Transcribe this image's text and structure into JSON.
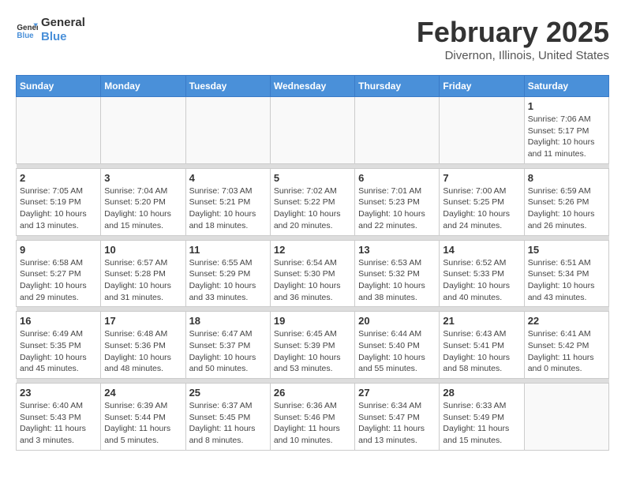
{
  "header": {
    "logo_line1": "General",
    "logo_line2": "Blue",
    "month_title": "February 2025",
    "location": "Divernon, Illinois, United States"
  },
  "weekdays": [
    "Sunday",
    "Monday",
    "Tuesday",
    "Wednesday",
    "Thursday",
    "Friday",
    "Saturday"
  ],
  "weeks": [
    [
      {
        "day": "",
        "info": ""
      },
      {
        "day": "",
        "info": ""
      },
      {
        "day": "",
        "info": ""
      },
      {
        "day": "",
        "info": ""
      },
      {
        "day": "",
        "info": ""
      },
      {
        "day": "",
        "info": ""
      },
      {
        "day": "1",
        "info": "Sunrise: 7:06 AM\nSunset: 5:17 PM\nDaylight: 10 hours\nand 11 minutes."
      }
    ],
    [
      {
        "day": "2",
        "info": "Sunrise: 7:05 AM\nSunset: 5:19 PM\nDaylight: 10 hours\nand 13 minutes."
      },
      {
        "day": "3",
        "info": "Sunrise: 7:04 AM\nSunset: 5:20 PM\nDaylight: 10 hours\nand 15 minutes."
      },
      {
        "day": "4",
        "info": "Sunrise: 7:03 AM\nSunset: 5:21 PM\nDaylight: 10 hours\nand 18 minutes."
      },
      {
        "day": "5",
        "info": "Sunrise: 7:02 AM\nSunset: 5:22 PM\nDaylight: 10 hours\nand 20 minutes."
      },
      {
        "day": "6",
        "info": "Sunrise: 7:01 AM\nSunset: 5:23 PM\nDaylight: 10 hours\nand 22 minutes."
      },
      {
        "day": "7",
        "info": "Sunrise: 7:00 AM\nSunset: 5:25 PM\nDaylight: 10 hours\nand 24 minutes."
      },
      {
        "day": "8",
        "info": "Sunrise: 6:59 AM\nSunset: 5:26 PM\nDaylight: 10 hours\nand 26 minutes."
      }
    ],
    [
      {
        "day": "9",
        "info": "Sunrise: 6:58 AM\nSunset: 5:27 PM\nDaylight: 10 hours\nand 29 minutes."
      },
      {
        "day": "10",
        "info": "Sunrise: 6:57 AM\nSunset: 5:28 PM\nDaylight: 10 hours\nand 31 minutes."
      },
      {
        "day": "11",
        "info": "Sunrise: 6:55 AM\nSunset: 5:29 PM\nDaylight: 10 hours\nand 33 minutes."
      },
      {
        "day": "12",
        "info": "Sunrise: 6:54 AM\nSunset: 5:30 PM\nDaylight: 10 hours\nand 36 minutes."
      },
      {
        "day": "13",
        "info": "Sunrise: 6:53 AM\nSunset: 5:32 PM\nDaylight: 10 hours\nand 38 minutes."
      },
      {
        "day": "14",
        "info": "Sunrise: 6:52 AM\nSunset: 5:33 PM\nDaylight: 10 hours\nand 40 minutes."
      },
      {
        "day": "15",
        "info": "Sunrise: 6:51 AM\nSunset: 5:34 PM\nDaylight: 10 hours\nand 43 minutes."
      }
    ],
    [
      {
        "day": "16",
        "info": "Sunrise: 6:49 AM\nSunset: 5:35 PM\nDaylight: 10 hours\nand 45 minutes."
      },
      {
        "day": "17",
        "info": "Sunrise: 6:48 AM\nSunset: 5:36 PM\nDaylight: 10 hours\nand 48 minutes."
      },
      {
        "day": "18",
        "info": "Sunrise: 6:47 AM\nSunset: 5:37 PM\nDaylight: 10 hours\nand 50 minutes."
      },
      {
        "day": "19",
        "info": "Sunrise: 6:45 AM\nSunset: 5:39 PM\nDaylight: 10 hours\nand 53 minutes."
      },
      {
        "day": "20",
        "info": "Sunrise: 6:44 AM\nSunset: 5:40 PM\nDaylight: 10 hours\nand 55 minutes."
      },
      {
        "day": "21",
        "info": "Sunrise: 6:43 AM\nSunset: 5:41 PM\nDaylight: 10 hours\nand 58 minutes."
      },
      {
        "day": "22",
        "info": "Sunrise: 6:41 AM\nSunset: 5:42 PM\nDaylight: 11 hours\nand 0 minutes."
      }
    ],
    [
      {
        "day": "23",
        "info": "Sunrise: 6:40 AM\nSunset: 5:43 PM\nDaylight: 11 hours\nand 3 minutes."
      },
      {
        "day": "24",
        "info": "Sunrise: 6:39 AM\nSunset: 5:44 PM\nDaylight: 11 hours\nand 5 minutes."
      },
      {
        "day": "25",
        "info": "Sunrise: 6:37 AM\nSunset: 5:45 PM\nDaylight: 11 hours\nand 8 minutes."
      },
      {
        "day": "26",
        "info": "Sunrise: 6:36 AM\nSunset: 5:46 PM\nDaylight: 11 hours\nand 10 minutes."
      },
      {
        "day": "27",
        "info": "Sunrise: 6:34 AM\nSunset: 5:47 PM\nDaylight: 11 hours\nand 13 minutes."
      },
      {
        "day": "28",
        "info": "Sunrise: 6:33 AM\nSunset: 5:49 PM\nDaylight: 11 hours\nand 15 minutes."
      },
      {
        "day": "",
        "info": ""
      }
    ]
  ]
}
